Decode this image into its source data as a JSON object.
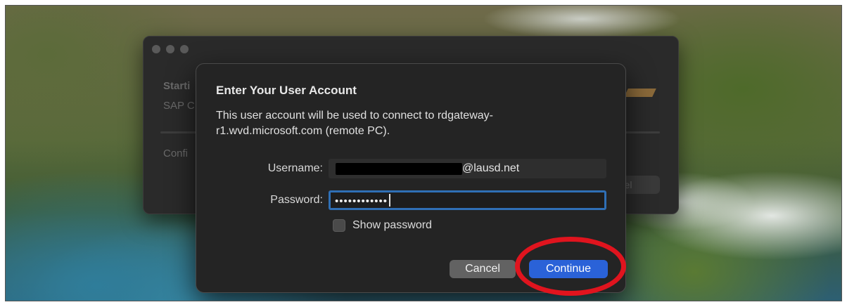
{
  "background_window": {
    "title_fragment": "Starti",
    "line2_fragment": "SAP C",
    "line3_fragment": "Confi",
    "button_fragment": "el"
  },
  "dialog": {
    "title": "Enter Your User Account",
    "description": "This user account will be used to connect to rdgateway-r1.wvd.microsoft.com (remote PC).",
    "username_label": "Username:",
    "username_value": "@lausd.net",
    "password_label": "Password:",
    "password_value": "••••••••••••",
    "show_password_label": "Show password",
    "show_password_checked": false,
    "cancel_label": "Cancel",
    "continue_label": "Continue"
  },
  "annotation": {
    "highlight_color": "#e0141e",
    "highlighted_target": "Continue"
  },
  "colors": {
    "accent": "#2a62d8",
    "focus_ring": "#2f6fb5",
    "dialog_bg": "#242424"
  }
}
